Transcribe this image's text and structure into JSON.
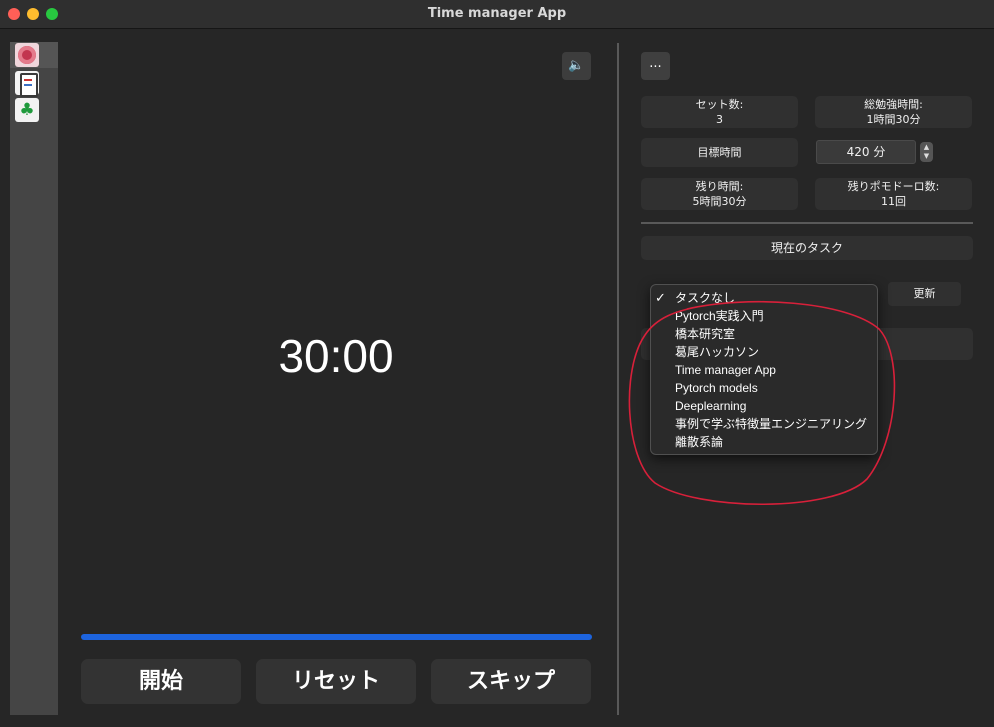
{
  "window": {
    "title": "Time manager App"
  },
  "sidebar": {
    "items": [
      {
        "icon": "tomato-icon"
      },
      {
        "icon": "clipboard-icon"
      },
      {
        "icon": "clover-icon"
      }
    ]
  },
  "timer": {
    "display": "30:00",
    "progress_fraction": 1.0
  },
  "controls": {
    "mute_icon": "🔈",
    "start_label": "開始",
    "reset_label": "リセット",
    "skip_label": "スキップ"
  },
  "right_panel": {
    "menu_button_label": "...",
    "sets": {
      "label": "セット数:",
      "value": "3"
    },
    "total_study": {
      "label": "総勉強時間:",
      "value": "1時間30分"
    },
    "target_label": "目標時間",
    "target_value": "420 分",
    "remaining_time": {
      "label": "残り時間:",
      "value": "5時間30分"
    },
    "remaining_pomodoros": {
      "label": "残りポモドーロ数:",
      "value": "11回"
    },
    "current_task_label": "現在のタスク",
    "update_button_label": "更新"
  },
  "task_dropdown": {
    "selected": "タスクなし",
    "check_mark": "✓",
    "options": [
      "タスクなし",
      "Pytorch実践入門",
      "橋本研究室",
      "葛尾ハッカソン",
      "Time manager App",
      "Pytorch models",
      "Deeplearning",
      "事例で学ぶ特徴量エンジニアリング",
      "離散系論"
    ]
  },
  "colors": {
    "accent": "#1d64de",
    "annotation": "#d8203a"
  }
}
